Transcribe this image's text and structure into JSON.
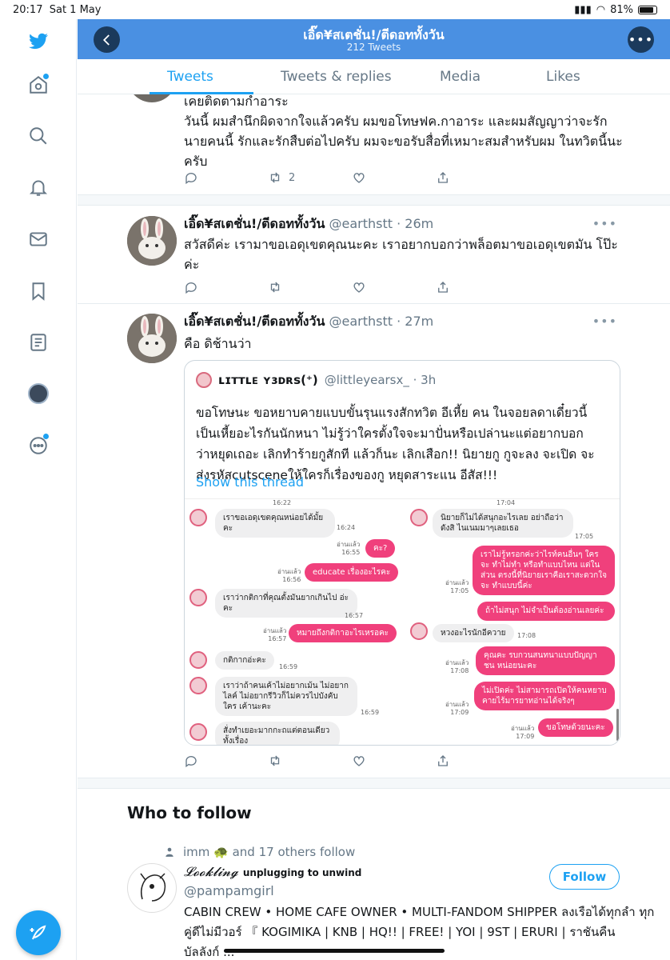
{
  "status_bar": {
    "time": "20:17",
    "date": "Sat 1 May",
    "battery": "81%"
  },
  "header": {
    "title": "เอิ๊ด¥สเตชั่น!/ตีดอททั้งวัน",
    "subtitle": "212 Tweets"
  },
  "tabs": [
    {
      "label": "Tweets",
      "active": true
    },
    {
      "label": "Tweets & replies",
      "active": false
    },
    {
      "label": "Media",
      "active": false
    },
    {
      "label": "Likes",
      "active": false
    }
  ],
  "tweets": [
    {
      "text_lines": [
        "เคยติดตามกำอาระ",
        "วันนี้ ผมสำนึกผิดจากใจแล้วครับ ผมขอโทษฟค.กาอาระ และผมสัญญาว่าจะรัก",
        "นายคนนี้ รักและรักสืบต่อไปครับ ผมจะขอรับสื่อที่เหมาะสมสำหรับผม ในทวิตนี้นะ",
        "ครับ"
      ],
      "retweets": "2"
    },
    {
      "name": "เอิ๊ด¥สเตชั่น!/ตีดอททั้งวัน",
      "handle": "@earthstt · 26m",
      "text_lines": [
        "สวัสดีค่ะ เรามาขอเอดุเขตคุณนะคะ เราอยากบอกว่าพล็อตมาขอเอดุเขตมัน โป๊ะ",
        "ค่ะ"
      ]
    },
    {
      "name": "เอิ๊ด¥สเตชั่น!/ตีดอททั้งวัน",
      "handle": "@earthstt · 27m",
      "text": "คือ ดิช้านว่า",
      "quote": {
        "name": "ʟɪᴛᴛʟᴇ ʏɜᴅʀs(⁺)",
        "handle": "@littleyearsx_ · 3h",
        "text_lines": [
          "ขอโทษนะ ขอหยาบคายแบบขั้นรุนแรงสักทวิต อีเหี้ย คน ในจอยลดาเดี๋ยวนี้",
          "เป็นเหี้ยอะไรกันนักหนา ไม่รู้ว่าใครตั้งใจจะมาปั่นหรือเปล่านะแต่อยากบอก",
          "ว่าหยุดเถอะ เลิกทำร้ายกูสักที แล้วก็นะ เลิกเสือก!! นิยายกู กูจะลง จะเปิด จะ",
          "ส่งรหัสcutsceneให้ใครก็เรื่องของกู หยุดสาระแน อีสัส!!!"
        ],
        "show_thread": "Show this thread",
        "chat_left": {
          "top_time": "16:22",
          "msgs": [
            {
              "text": "เราขอเอดุเขตคุณหน่อยได้มั้ยคะ",
              "time": "16:24"
            },
            {
              "text": "เราว่ากติกาที่คุณตั้งมันยากเกินไป อ่ะคะ",
              "time": "16:57"
            },
            {
              "text": "กติกากอ่ะคะ",
              "time": "16:59"
            },
            {
              "text": "เราว่าถ้าคนเค้าไม่อยากเม้น ไม่อยาก ไลค์ ไม่อยากรีวิวก็ไม่ควรไปบังคับใคร เค้านะคะ",
              "time": "16:59"
            },
            {
              "text": "สั่งทำเยอะมากกะถแต่ตอนเดียว ทั้งเรื่อง",
              "time": ""
            }
          ],
          "replies": [
            {
              "text": "คะ?",
              "read": "อ่านแล้ว",
              "time": "16:55"
            },
            {
              "text": "educate เรื่องอะไรคะ",
              "read": "อ่านแล้ว",
              "time": "16:56"
            },
            {
              "text": "หมายถึงกติกาอะไรเหรอคะ",
              "read": "อ่านแล้ว",
              "time": "16:57"
            }
          ]
        },
        "chat_right": {
          "top_time": "17:04",
          "msgs": [
            {
              "text": "นิยายก็ไม่ได้สนุกอะไรเลย อย่าถือว่า ดังสิ ไนเนมมาๆเลยเธอ",
              "time": "17:05"
            },
            {
              "text": "หวงอะไรนักอีควาย",
              "time": "17:08"
            }
          ],
          "replies": [
            {
              "text": "เราไม่รู้หรอกค่ะว่าไรท์คนอื่นๆ ใครจะ ทำไม่ทำ หรือทำแบบไหน แต่ในส่วน ตรงนี้ที่นิยายเราคือเราสะดวกใจจะ ทำแบบนี้ค่ะ",
              "read": "อ่านแล้ว",
              "time": "17:05"
            },
            {
              "text": "ถ้าไม่สนุก ไม่จำเป็นต้องอ่านเลยค่ะ",
              "read": "",
              "time": ""
            },
            {
              "text": "คุณคะ รบกวนสนทนาแบบปัญญาชน หน่อยนะคะ",
              "read": "อ่านแล้ว",
              "time": "17:08"
            },
            {
              "text": "ไม่เปิดค่ะ ไม่สามารถเปิดให้คนหยาบ คายไร้มารยาทอ่านได้จริงๆ",
              "read": "อ่านแล้ว",
              "time": "17:09"
            },
            {
              "text": "ขอโทษด้วยนะคะ",
              "read": "อ่านแล้ว",
              "time": "17:09"
            }
          ]
        }
      }
    }
  ],
  "who_to_follow": {
    "heading": "Who to follow",
    "social_context": "imm 🐢 and 17 others follow",
    "name": "𝓛𝓸𝓸𝓴𝓵𝓲𝓷𝓰",
    "name_suffix": "unplugging to unwind",
    "handle": "@pampamgirl",
    "follow_label": "Follow",
    "bio_lines": [
      "CABIN CREW • HOME CAFE OWNER • MULTI-FANDOM SHIPPER ลงเรือได้ทุกลำ ทุก",
      "คู่ดีไม่มีวอร์ 『 KOGIMIKA | KNB | HQ!! | FREE! | YOI | 9ST | ERURI | ราชันคืน",
      "บัลลังก์ ..."
    ]
  },
  "colors": {
    "accent": "#1da1f2",
    "header_bg": "#4a90e2",
    "chat_pink": "#f0407c"
  }
}
